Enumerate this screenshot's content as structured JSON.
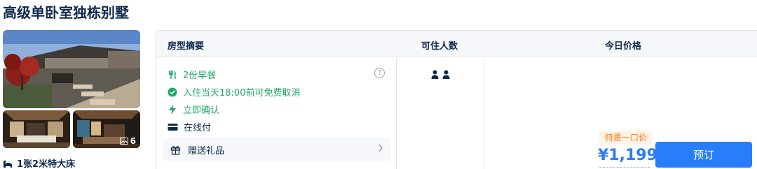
{
  "room": {
    "title": "高级单卧室独栋别墅",
    "photo_count": "6",
    "bed": "1张2米特大床"
  },
  "table": {
    "headers": {
      "summary": "房型摘要",
      "guests": "可住人数",
      "price": "今日价格"
    },
    "features": [
      {
        "icon": "utensils-icon",
        "text": "2份早餐",
        "color": "#24a86a"
      },
      {
        "icon": "check-circle-icon",
        "text": "入住当天18:00前可免费取消",
        "color": "#24a86a"
      },
      {
        "icon": "lightning-icon",
        "text": "立即确认",
        "color": "#24a86a"
      },
      {
        "icon": "credit-card-icon",
        "text": "在线付",
        "color": "#0f294d"
      }
    ],
    "gift": "赠送礼品",
    "guest_icons": [
      "person-icon",
      "person-icon"
    ]
  },
  "offer": {
    "badge": "特惠一口价",
    "price": "¥1,199",
    "book_label": "预订"
  },
  "colors": {
    "accent": "#287dfa",
    "green": "#24a86a",
    "deal": "#ff7d13",
    "text": "#0f294d"
  }
}
